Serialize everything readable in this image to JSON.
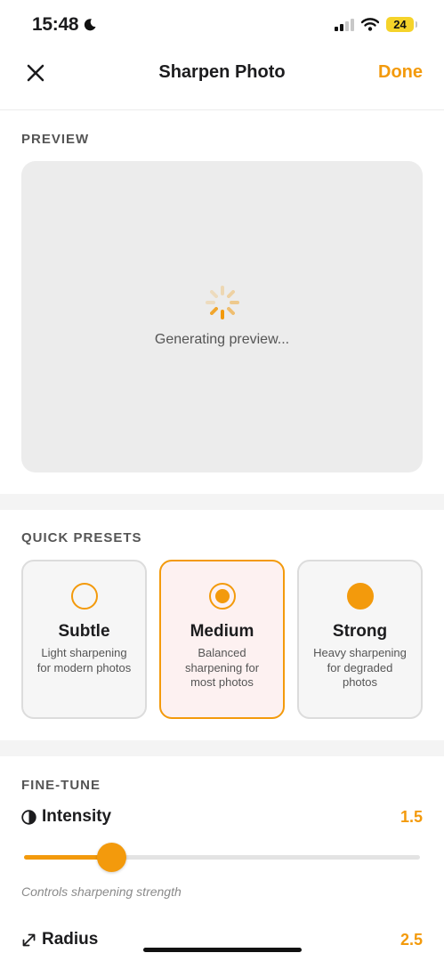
{
  "status_bar": {
    "time": "15:48",
    "battery": "24"
  },
  "nav": {
    "title": "Sharpen Photo",
    "done_label": "Done"
  },
  "preview": {
    "section_label": "PREVIEW",
    "loading_text": "Generating preview..."
  },
  "presets": {
    "section_label": "QUICK PRESETS",
    "items": [
      {
        "name": "Subtle",
        "description": "Light sharpening for modern photos",
        "selected": false
      },
      {
        "name": "Medium",
        "description": "Balanced sharpening for most photos",
        "selected": true
      },
      {
        "name": "Strong",
        "description": "Heavy sharpening for degraded photos",
        "selected": false
      }
    ]
  },
  "fine_tune": {
    "section_label": "FINE-TUNE",
    "intensity": {
      "label": "Intensity",
      "value": "1.5",
      "hint": "Controls sharpening strength",
      "fill_fraction": 0.22
    },
    "radius": {
      "label": "Radius",
      "value": "2.5"
    }
  },
  "colors": {
    "accent": "#f39a0c",
    "selected_bg": "#fdf1f1",
    "preview_bg": "#ececec"
  },
  "icons": {
    "close": "close-icon",
    "intensity": "contrast-icon",
    "radius": "resize-arrows-icon",
    "spinner": "loading-spinner-icon"
  }
}
